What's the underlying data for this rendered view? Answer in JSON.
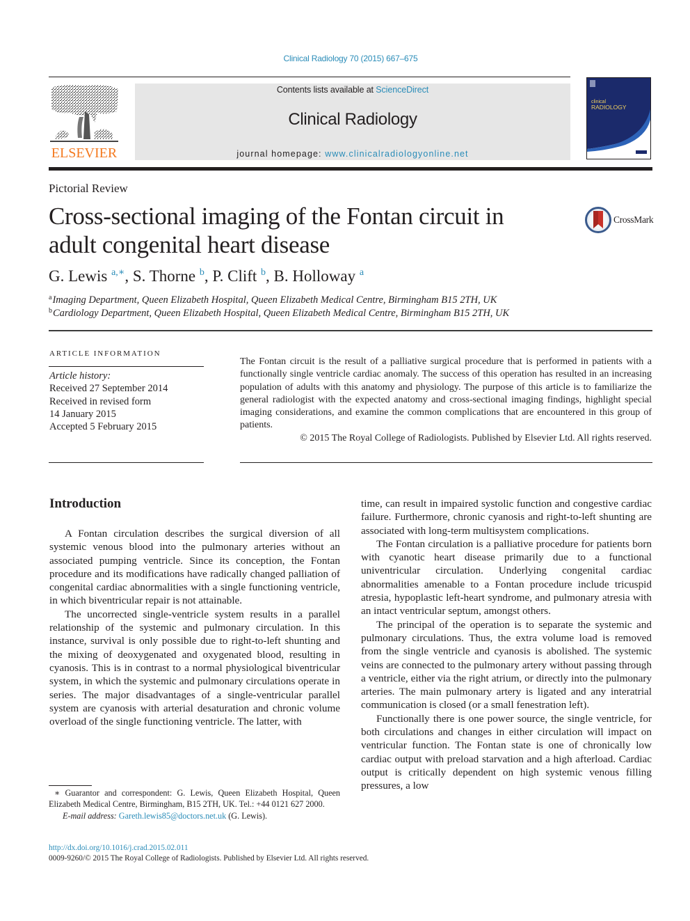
{
  "running_head": "Clinical Radiology 70 (2015) 667–675",
  "masthead": {
    "publisher_logo_text": "ELSEVIER",
    "contents_prefix": "Contents lists available at ",
    "contents_link": "ScienceDirect",
    "journal_title": "Clinical Radiology",
    "homepage_prefix": "journal homepage: ",
    "homepage_link": "www.clinicalradiologyonline.net",
    "cover_title_top": "clinical",
    "cover_title_bottom": "RADIOLOGY"
  },
  "colors": {
    "link": "#2a8cb8",
    "elsevier_orange": "#f47a20",
    "band_gray": "#e6e6e6",
    "cover_blue": "#1b2a6b"
  },
  "article": {
    "type": "Pictorial Review",
    "title": "Cross-sectional imaging of the Fontan circuit in adult congenital heart disease",
    "crossmark_label": "CrossMark",
    "authors": [
      {
        "name": "G. Lewis",
        "sup": "a,∗"
      },
      {
        "name": "S. Thorne",
        "sup": "b"
      },
      {
        "name": "P. Clift",
        "sup": "b"
      },
      {
        "name": "B. Holloway",
        "sup": "a"
      }
    ],
    "affiliations": [
      {
        "label": "a",
        "text": "Imaging Department, Queen Elizabeth Hospital, Queen Elizabeth Medical Centre, Birmingham B15 2TH, UK"
      },
      {
        "label": "b",
        "text": "Cardiology Department, Queen Elizabeth Hospital, Queen Elizabeth Medical Centre, Birmingham B15 2TH, UK"
      }
    ]
  },
  "article_info": {
    "heading": "ARTICLE INFORMATION",
    "history_label": "Article history:",
    "history": [
      "Received 27 September 2014",
      "Received in revised form",
      "14 January 2015",
      "Accepted 5 February 2015"
    ]
  },
  "abstract": {
    "text": "The Fontan circuit is the result of a palliative surgical procedure that is performed in patients with a functionally single ventricle cardiac anomaly. The success of this operation has resulted in an increasing population of adults with this anatomy and physiology. The purpose of this article is to familiarize the general radiologist with the expected anatomy and cross-sectional imaging findings, highlight special imaging considerations, and examine the common complications that are encountered in this group of patients.",
    "copyright": "© 2015 The Royal College of Radiologists. Published by Elsevier Ltd. All rights reserved."
  },
  "body": {
    "section_heading": "Introduction",
    "left_paragraphs": [
      "A Fontan circulation describes the surgical diversion of all systemic venous blood into the pulmonary arteries without an associated pumping ventricle. Since its conception, the Fontan procedure and its modifications have radically changed palliation of congenital cardiac abnormalities with a single functioning ventricle, in which biventricular repair is not attainable.",
      "The uncorrected single-ventricle system results in a parallel relationship of the systemic and pulmonary circulation. In this instance, survival is only possible due to right-to-left shunting and the mixing of deoxygenated and oxygenated blood, resulting in cyanosis. This is in contrast to a normal physiological biventricular system, in which the systemic and pulmonary circulations operate in series. The major disadvantages of a single-ventricular parallel system are cyanosis with arterial desaturation and chronic volume overload of the single functioning ventricle. The latter, with"
    ],
    "right_paragraphs": [
      "time, can result in impaired systolic function and congestive cardiac failure. Furthermore, chronic cyanosis and right-to-left shunting are associated with long-term multisystem complications.",
      "The Fontan circulation is a palliative procedure for patients born with cyanotic heart disease primarily due to a functional univentricular circulation. Underlying congenital cardiac abnormalities amenable to a Fontan procedure include tricuspid atresia, hypoplastic left-heart syndrome, and pulmonary atresia with an intact ventricular septum, amongst others.",
      "The principal of the operation is to separate the systemic and pulmonary circulations. Thus, the extra volume load is removed from the single ventricle and cyanosis is abolished. The systemic veins are connected to the pulmonary artery without passing through a ventricle, either via the right atrium, or directly into the pulmonary arteries. The main pulmonary artery is ligated and any interatrial communication is closed (or a small fenestration left).",
      "Functionally there is one power source, the single ventricle, for both circulations and changes in either circulation will impact on ventricular function. The Fontan state is one of chronically low cardiac output with preload starvation and a high afterload. Cardiac output is critically dependent on high systemic venous filling pressures, a low"
    ]
  },
  "footnote": {
    "marker": "∗",
    "text": "Guarantor and correspondent: G. Lewis, Queen Elizabeth Hospital, Queen Elizabeth Medical Centre, Birmingham, B15 2TH, UK. Tel.: +44 0121 627 2000.",
    "email_label": "E-mail address: ",
    "email": "Gareth.lewis85@doctors.net.uk",
    "email_suffix": " (G. Lewis)."
  },
  "page_footer": {
    "doi": "http://dx.doi.org/10.1016/j.crad.2015.02.011",
    "issn_line": "0009-9260/© 2015 The Royal College of Radiologists. Published by Elsevier Ltd. All rights reserved."
  }
}
